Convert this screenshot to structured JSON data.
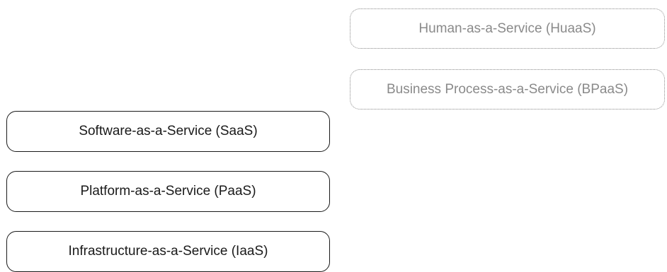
{
  "diagram": {
    "optional_layers": [
      {
        "label": "Human-as-a-Service (HuaaS)"
      },
      {
        "label": "Business Process-as-a-Service (BPaaS)"
      }
    ],
    "core_layers": [
      {
        "label": "Software-as-a-Service (SaaS)"
      },
      {
        "label": "Platform-as-a-Service (PaaS)"
      },
      {
        "label": "Infrastructure-as-a-Service (IaaS)"
      }
    ]
  },
  "colors": {
    "core_border": "#1a1a1a",
    "optional_border": "#8a8a8a",
    "background": "#ffffff"
  }
}
